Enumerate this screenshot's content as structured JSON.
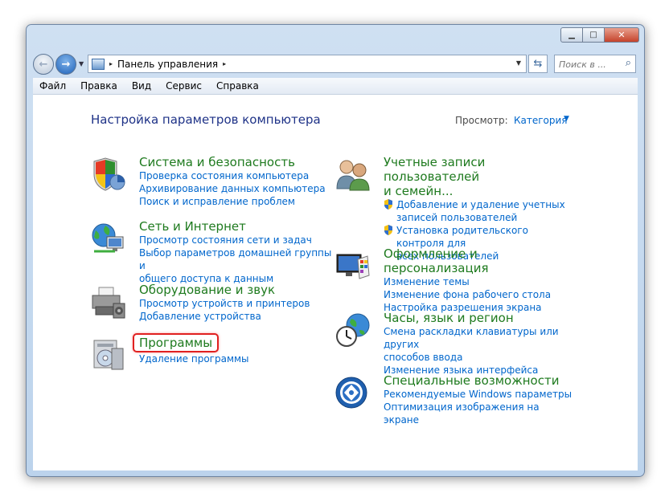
{
  "window": {
    "min_label": "▁",
    "max_label": "□",
    "close_label": "✕"
  },
  "address_bar": {
    "arrow": "▸",
    "crumb": "Панель управления",
    "crumb_arrow": "▸",
    "drop": "▼"
  },
  "search": {
    "placeholder": "Поиск в ..."
  },
  "menu": [
    "Файл",
    "Правка",
    "Вид",
    "Сервис",
    "Справка"
  ],
  "content": {
    "title": "Настройка параметров компьютера",
    "view_label": "Просмотр:",
    "view_value": "Категория",
    "view_arrow": "▼"
  },
  "left_categories": [
    {
      "title": "Система и безопасность",
      "links": [
        "Проверка состояния компьютера",
        "Архивирование данных компьютера",
        "Поиск и исправление проблем"
      ]
    },
    {
      "title": "Сеть и Интернет",
      "links": [
        "Просмотр состояния сети и задач",
        "Выбор параметров домашней группы и",
        "общего доступа к данным"
      ]
    },
    {
      "title": "Оборудование и звук",
      "links": [
        "Просмотр устройств и принтеров",
        "Добавление устройства"
      ]
    },
    {
      "title": "Программы",
      "links": [
        "Удаление программы"
      ]
    }
  ],
  "right_categories": [
    {
      "title_lines": [
        "Учетные записи пользователей",
        "и семейн..."
      ],
      "links": [
        "Добавление и удаление учетных",
        "записей пользователей",
        "Установка родительского контроля для",
        "всех пользователей"
      ]
    },
    {
      "title": "Оформление и персонализация",
      "links": [
        "Изменение темы",
        "Изменение фона рабочего стола",
        "Настройка разрешения экрана"
      ]
    },
    {
      "title": "Часы, язык и регион",
      "links": [
        "Смена раскладки клавиатуры или других",
        "способов ввода",
        "Изменение языка интерфейса"
      ]
    },
    {
      "title": "Специальные возможности",
      "links": [
        "Рекомендуемые Windows параметры",
        "Оптимизация изображения на экране"
      ]
    }
  ]
}
